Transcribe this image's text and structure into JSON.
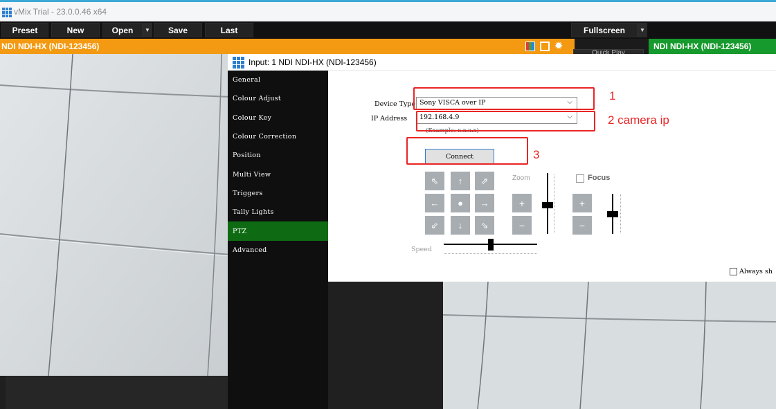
{
  "window": {
    "title": "vMix Trial - 23.0.0.46 x64"
  },
  "toolbar": {
    "preset": "Preset",
    "new": "New",
    "open": "Open",
    "save": "Save",
    "last": "Last",
    "fullscreen": "Fullscreen",
    "quick_play": "Quick Play"
  },
  "preview": {
    "label": "NDI NDI-HX (NDI-123456)"
  },
  "output": {
    "label": "NDI NDI-HX (NDI-123456)"
  },
  "dialog": {
    "title": "Input: 1 NDI NDI-HX (NDI-123456)",
    "sidebar": [
      {
        "label": "General"
      },
      {
        "label": "Colour Adjust"
      },
      {
        "label": "Colour Key"
      },
      {
        "label": "Colour Correction"
      },
      {
        "label": "Position"
      },
      {
        "label": "Multi View"
      },
      {
        "label": "Triggers"
      },
      {
        "label": "Tally Lights"
      },
      {
        "label": "PTZ"
      },
      {
        "label": "Advanced"
      }
    ],
    "active_item": "PTZ",
    "ptz": {
      "device_type_label": "Device Type",
      "device_type_value": "Sony VISCA over IP",
      "ip_label": "IP Address",
      "ip_value": "192.168.4.9",
      "ip_hint": "(Example: x.x.x.x)",
      "connect": "Connect",
      "zoom_label": "Zoom",
      "focus_label": "Focus",
      "speed_label": "Speed",
      "always_label": "Always sh"
    }
  },
  "annotations": {
    "one": "1",
    "two": "2 camera ip",
    "three": "3",
    "color": "#ea2525"
  },
  "colors": {
    "preview_bar": "#f39a12",
    "output_bar": "#179a2d",
    "active_tab": "#0e6b13",
    "pad_button": "#a8adb2"
  }
}
